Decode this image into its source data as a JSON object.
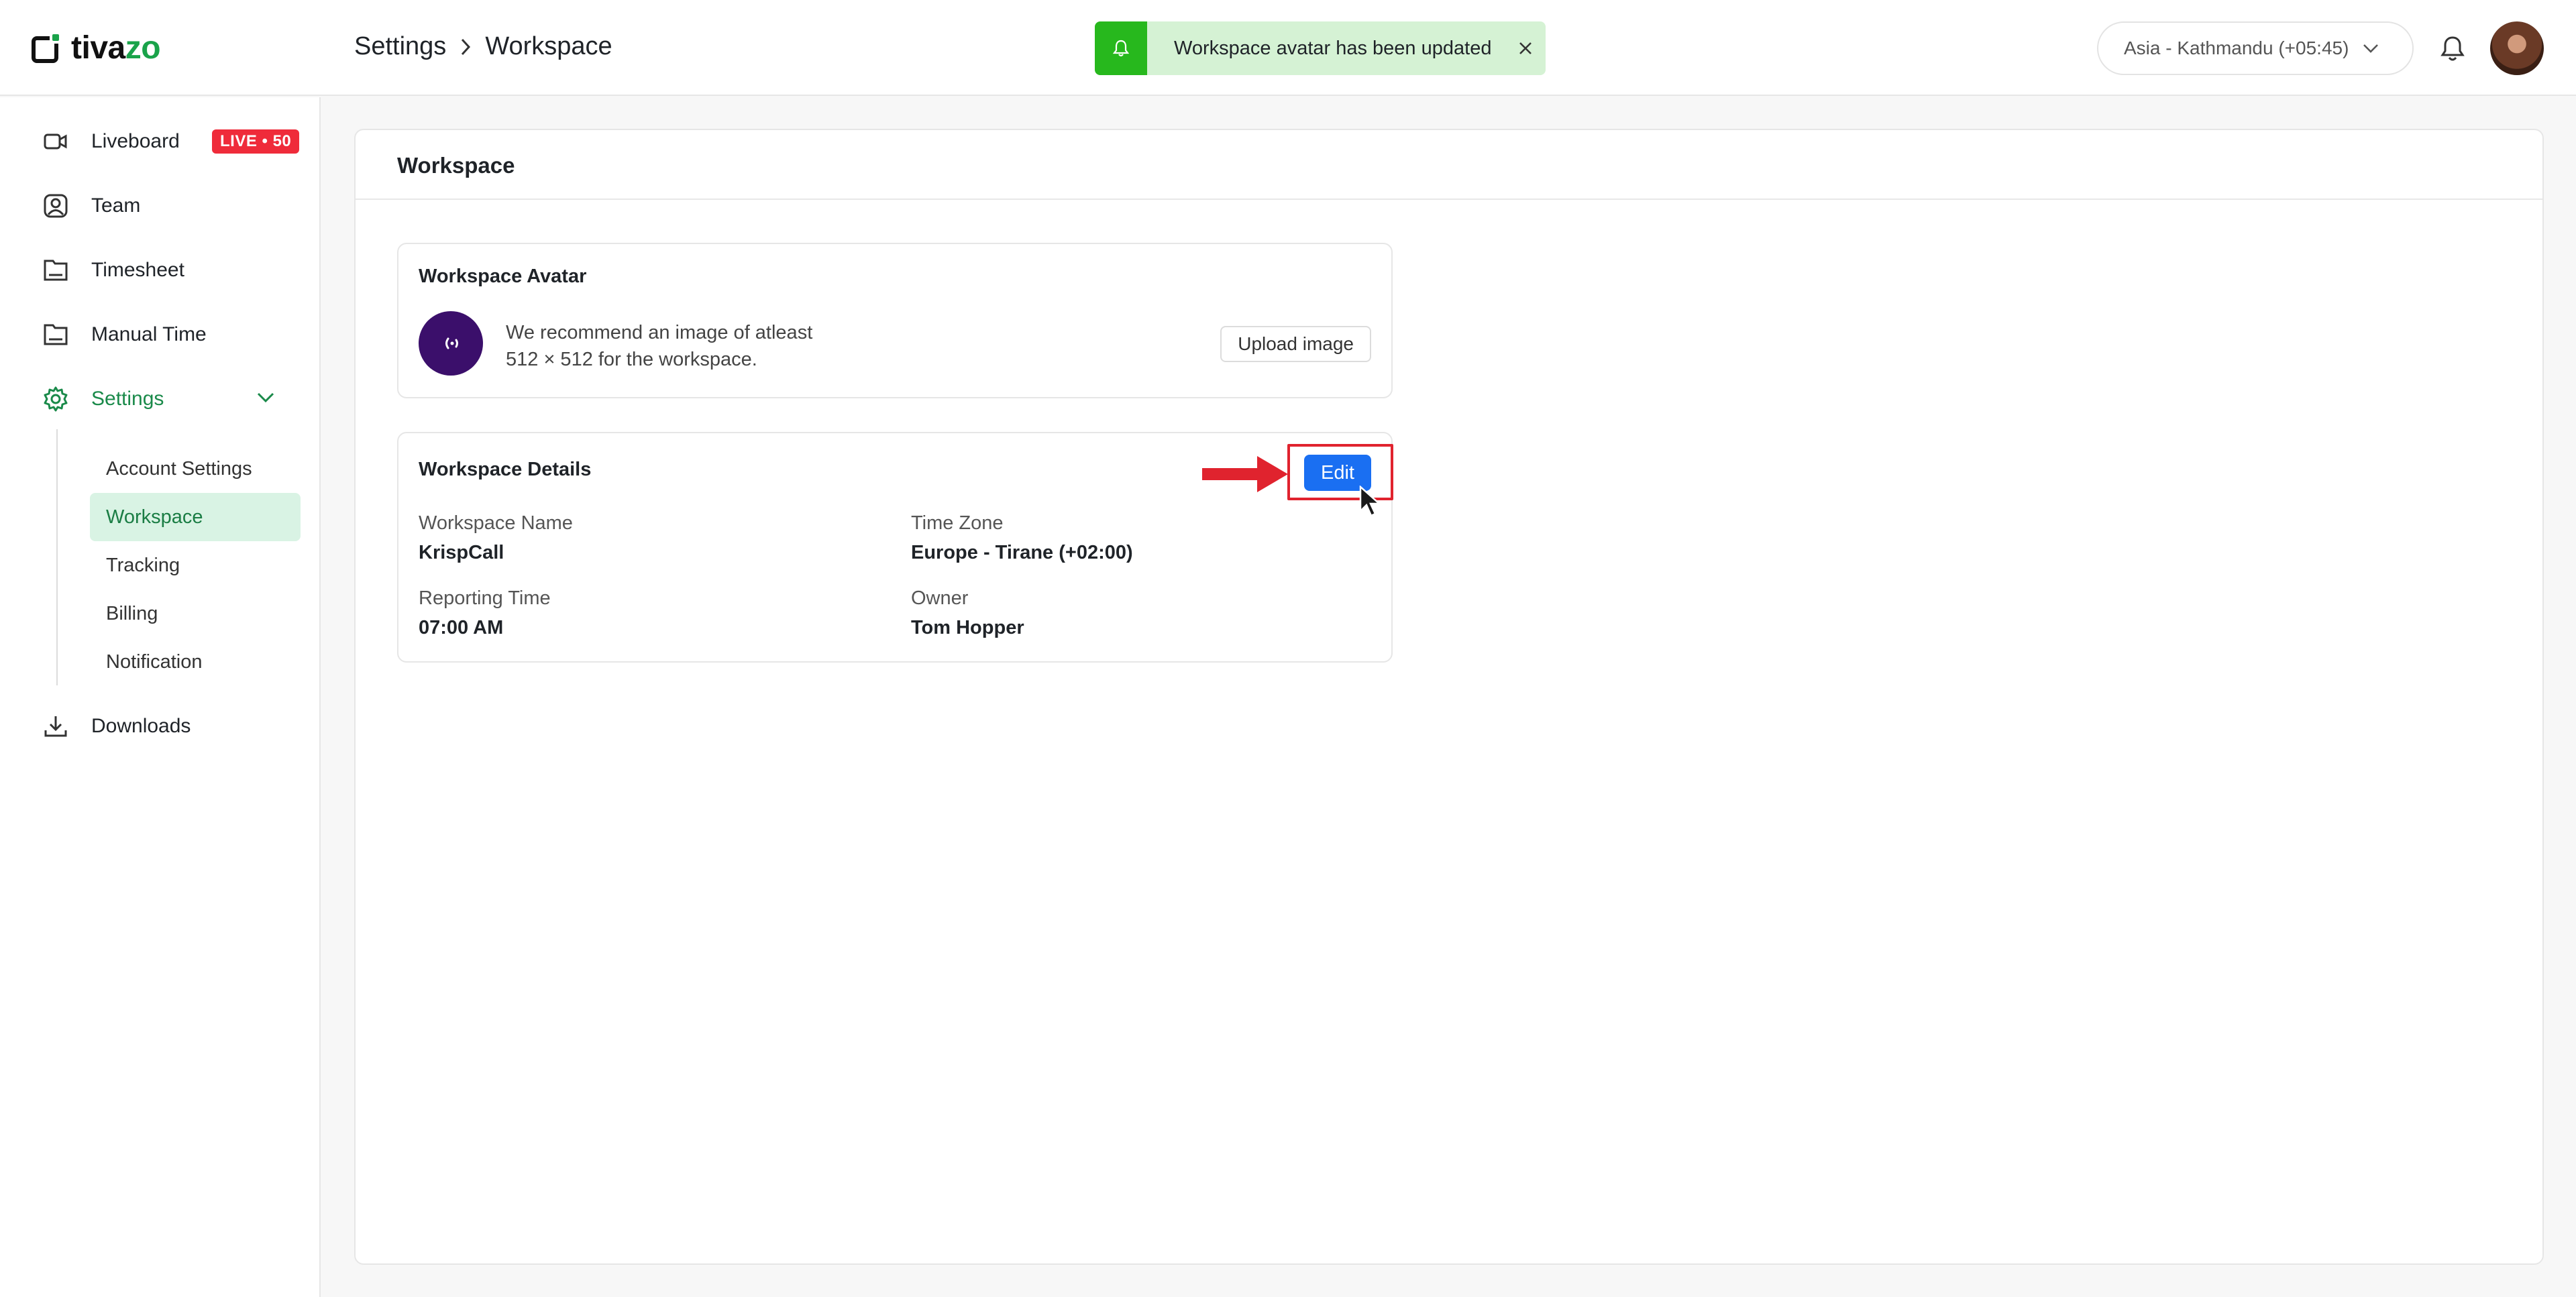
{
  "app": {
    "logo_text": "tivazo"
  },
  "header": {
    "breadcrumb": [
      "Settings",
      "Workspace"
    ],
    "toast": "Workspace avatar has been updated",
    "timezone_select": "Asia - Kathmandu (+05:45)"
  },
  "sidebar": {
    "items": [
      {
        "label": "Liveboard",
        "icon": "video-icon"
      },
      {
        "label": "Team",
        "icon": "user-icon"
      },
      {
        "label": "Timesheet",
        "icon": "folder-icon"
      },
      {
        "label": "Manual Time",
        "icon": "folder-icon"
      },
      {
        "label": "Settings",
        "icon": "gear-icon"
      },
      {
        "label": "Downloads",
        "icon": "download-icon"
      }
    ],
    "live_badge": "LIVE • 50",
    "settings_sub": [
      "Account Settings",
      "Workspace",
      "Tracking",
      "Billing",
      "Notification"
    ],
    "selected_sub": "Workspace"
  },
  "main": {
    "title": "Workspace",
    "avatar_panel": {
      "title": "Workspace Avatar",
      "recommend_line1": "We recommend an image of atleast",
      "recommend_line2": "512 × 512 for the workspace.",
      "upload_label": "Upload image"
    },
    "details_panel": {
      "title": "Workspace Details",
      "edit_label": "Edit",
      "fields": [
        {
          "label": "Workspace Name",
          "value": "KrispCall"
        },
        {
          "label": "Time Zone",
          "value": "Europe - Tirane (+02:00)"
        },
        {
          "label": "Reporting Time",
          "value": "07:00 AM"
        },
        {
          "label": "Owner",
          "value": "Tom Hopper"
        }
      ]
    }
  },
  "colors": {
    "brand_green": "#1aa34a",
    "toast_green": "#27b81d",
    "primary_blue": "#1a6ff2",
    "live_red": "#ef2b3a",
    "annotation_red": "#e0232e"
  }
}
